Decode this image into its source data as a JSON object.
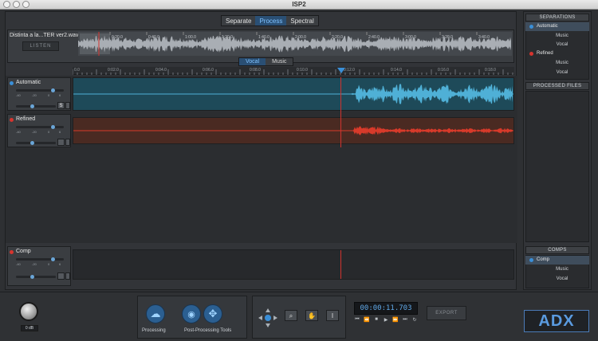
{
  "window": {
    "title": "ISP2"
  },
  "modes": [
    {
      "label": "Separate",
      "active": false
    },
    {
      "label": "Process",
      "active": true
    },
    {
      "label": "Spectral",
      "active": false
    }
  ],
  "overview": {
    "filename": "Distinta a la...TER ver2.wav",
    "listen_label": "LISTEN",
    "ticks": [
      "0:20.0",
      "0:40.0",
      "1:00.0",
      "1:20.0",
      "1:40.0",
      "2:00.0",
      "2:20.0",
      "2:40.0",
      "3:00.0",
      "3:20.0",
      "3:40.0"
    ]
  },
  "subtabs": [
    {
      "label": "Vocal",
      "active": true
    },
    {
      "label": "Music",
      "active": false
    }
  ],
  "ruler": {
    "ticks": [
      "0.0",
      "0:02.0",
      "0:04.0",
      "0:06.0",
      "0:08.0",
      "0:10.0",
      "0:12.0",
      "0:14.0",
      "0:16.0",
      "0:18.0"
    ]
  },
  "tracks": [
    {
      "name": "Automatic",
      "led_color": "#3a8fd8",
      "lane_bg": "#1e4a59",
      "wave_color": "#4fb0d6",
      "button": "S"
    },
    {
      "name": "Refined",
      "led_color": "#d6342e",
      "lane_bg": "#4a2a22",
      "wave_color": "#d83a2a"
    }
  ],
  "mini_labels": [
    "-40",
    "-20",
    "0",
    "6"
  ],
  "comp": {
    "name": "Comp",
    "led_color": "#d6342e"
  },
  "sidebar": {
    "separations_header": "SEPARATIONS",
    "separations": [
      {
        "label": "Automatic",
        "led": "#3a8fd8",
        "selected": true,
        "children": [
          "Music",
          "Vocal"
        ]
      },
      {
        "label": "Refined",
        "led": "#d6342e",
        "selected": false,
        "children": [
          "Music",
          "Vocal"
        ]
      }
    ],
    "processed_header": "PROCESSED FILES",
    "comps_header": "COMPS",
    "comps": {
      "label": "Comp",
      "led": "#3a8fd8",
      "children": [
        "Music",
        "Vocal"
      ]
    }
  },
  "bottom": {
    "gain": "0 dB",
    "processing_label": "Processing",
    "post_label": "Post-Processing Tools",
    "time": "00:00:11.703",
    "export_label": "EXPORT",
    "logo": "ADX"
  }
}
